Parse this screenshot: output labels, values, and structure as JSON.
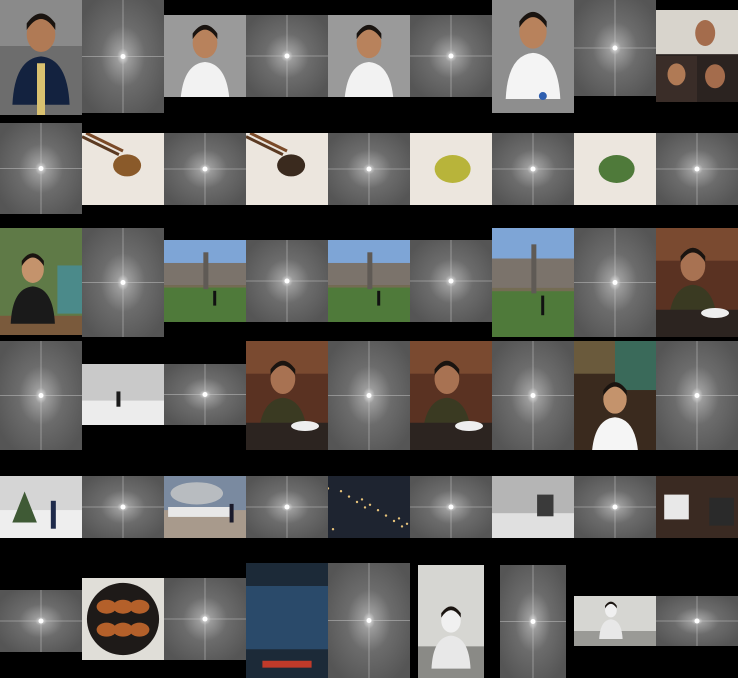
{
  "mosaic": {
    "background": "#000000",
    "columns": 9,
    "rows": 6,
    "tiles": [
      {
        "kind": "photo",
        "subject": "portrait-graduation"
      },
      {
        "kind": "spectrum"
      },
      {
        "kind": "photo",
        "subject": "portrait"
      },
      {
        "kind": "spectrum"
      },
      {
        "kind": "photo",
        "subject": "portrait"
      },
      {
        "kind": "spectrum"
      },
      {
        "kind": "photo",
        "subject": "portrait-uniform"
      },
      {
        "kind": "spectrum"
      },
      {
        "kind": "photo",
        "subject": "video-call"
      },
      {
        "kind": "spectrum"
      },
      {
        "kind": "photo",
        "subject": "chopsticks-leaf-brown"
      },
      {
        "kind": "spectrum"
      },
      {
        "kind": "photo",
        "subject": "chopsticks-leaf-dark"
      },
      {
        "kind": "spectrum"
      },
      {
        "kind": "photo",
        "subject": "leaf-yellow-green"
      },
      {
        "kind": "spectrum"
      },
      {
        "kind": "photo",
        "subject": "leaf-green"
      },
      {
        "kind": "spectrum"
      },
      {
        "kind": "photo",
        "subject": "woman-garden"
      },
      {
        "kind": "spectrum"
      },
      {
        "kind": "photo",
        "subject": "campus-trees"
      },
      {
        "kind": "spectrum"
      },
      {
        "kind": "photo",
        "subject": "campus-trees"
      },
      {
        "kind": "spectrum"
      },
      {
        "kind": "photo",
        "subject": "campus-trees"
      },
      {
        "kind": "spectrum"
      },
      {
        "kind": "photo",
        "subject": "man-dining"
      },
      {
        "kind": "spectrum"
      },
      {
        "kind": "photo",
        "subject": "snow-park"
      },
      {
        "kind": "spectrum"
      },
      {
        "kind": "photo",
        "subject": "man-dining"
      },
      {
        "kind": "spectrum"
      },
      {
        "kind": "photo",
        "subject": "man-dining"
      },
      {
        "kind": "spectrum"
      },
      {
        "kind": "photo",
        "subject": "woman-white-dress"
      },
      {
        "kind": "spectrum"
      },
      {
        "kind": "photo",
        "subject": "snow-tree"
      },
      {
        "kind": "spectrum"
      },
      {
        "kind": "photo",
        "subject": "seoul-sign"
      },
      {
        "kind": "spectrum"
      },
      {
        "kind": "photo",
        "subject": "city-night"
      },
      {
        "kind": "spectrum"
      },
      {
        "kind": "photo",
        "subject": "snowy-street"
      },
      {
        "kind": "spectrum"
      },
      {
        "kind": "photo",
        "subject": "desk-items"
      },
      {
        "kind": "spectrum"
      },
      {
        "kind": "photo",
        "subject": "roast-chicken"
      },
      {
        "kind": "spectrum"
      },
      {
        "kind": "photo",
        "subject": "inception-poster"
      },
      {
        "kind": "spectrum"
      },
      {
        "kind": "photo",
        "subject": "interstellar-poster"
      },
      {
        "kind": "spectrum"
      },
      {
        "kind": "photo",
        "subject": "astronaut-wide"
      },
      {
        "kind": "spectrum"
      }
    ]
  }
}
